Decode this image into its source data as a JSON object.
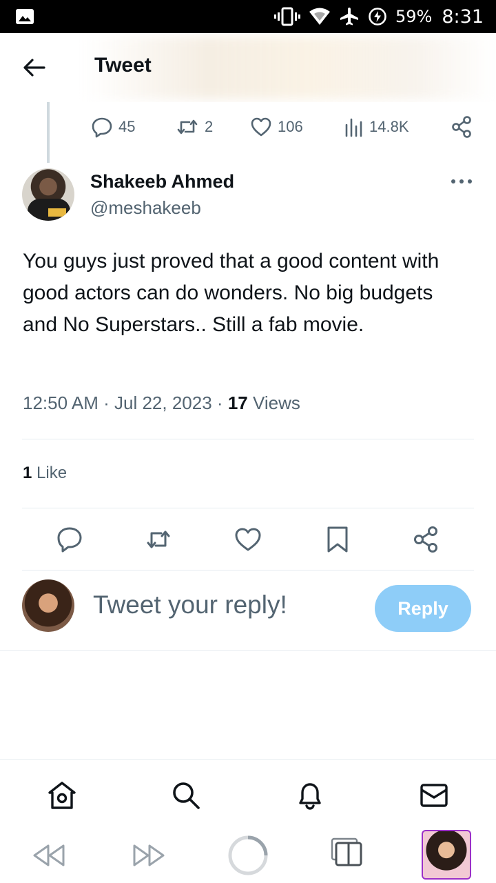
{
  "status_bar": {
    "battery": "59%",
    "time": "8:31"
  },
  "header": {
    "title": "Tweet"
  },
  "parent_metrics": {
    "replies": "45",
    "retweets": "2",
    "likes": "106",
    "views": "14.8K"
  },
  "tweet": {
    "author_name": "Shakeeb Ahmed",
    "author_handle": "@meshakeeb",
    "text": "You guys just proved that a good content with good actors can do wonders. No big budgets and No Superstars.. Still a fab movie.",
    "time": "12:50 AM",
    "separator": "·",
    "date": "Jul 22, 2023",
    "views_count": "17",
    "views_label": "Views",
    "likes_count": "1",
    "likes_label": "Like"
  },
  "reply": {
    "placeholder": "Tweet your reply!",
    "button": "Reply"
  },
  "colors": {
    "text_primary": "#0f1419",
    "text_secondary": "#536471",
    "reply_button": "#8ecdf8",
    "divider": "#e6ecf0"
  }
}
